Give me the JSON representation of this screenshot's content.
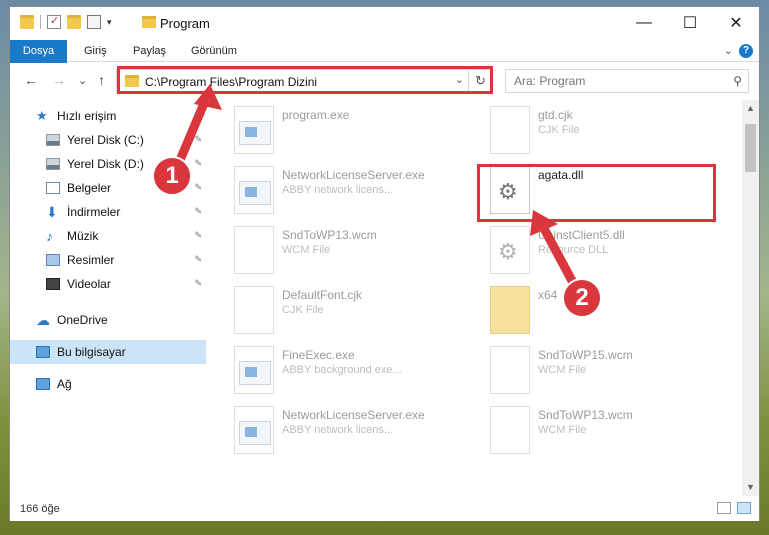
{
  "titlebar": {
    "title": "Program",
    "minimize": "—",
    "maximize": "☐",
    "close": "✕"
  },
  "ribbon": {
    "tabs": [
      "Dosya",
      "Giriş",
      "Paylaş",
      "Görünüm"
    ],
    "collapse": "⌄",
    "help": "?"
  },
  "nav": {
    "back": "←",
    "forward": "→",
    "recent": "⌄",
    "up": "↑",
    "address": "C:\\Program Files\\Program Dizini",
    "dropdown": "⌄",
    "refresh": "↻",
    "search_placeholder": "Ara: Program",
    "search_icon": "⚲"
  },
  "sidebar": {
    "items": [
      {
        "label": "Hızlı erişim",
        "icon": "star-icon"
      },
      {
        "label": "Yerel Disk (C:)",
        "icon": "drive-icon"
      },
      {
        "label": "Yerel Disk (D:)",
        "icon": "drive-icon"
      },
      {
        "label": "Belgeler",
        "icon": "documents-icon"
      },
      {
        "label": "İndirmeler",
        "icon": "downloads-icon"
      },
      {
        "label": "Müzik",
        "icon": "music-icon"
      },
      {
        "label": "Resimler",
        "icon": "pictures-icon"
      },
      {
        "label": "Videolar",
        "icon": "videos-icon"
      },
      {
        "label": "OneDrive",
        "icon": "onedrive-icon"
      },
      {
        "label": "Bu bilgisayar",
        "icon": "this-pc-icon"
      },
      {
        "label": "Ağ",
        "icon": "network-icon"
      }
    ],
    "pin": "📌"
  },
  "files": [
    {
      "name": "program.exe",
      "type": "",
      "kind": "exe"
    },
    {
      "name": "gtd.cjk",
      "type": "CJK File",
      "kind": "generic"
    },
    {
      "name": "NetworkLicenseServer.exe",
      "type": "ABBY network licens...",
      "kind": "exe"
    },
    {
      "name": "agata.dll",
      "type": "",
      "kind": "gear"
    },
    {
      "name": "SndToWP13.wcm",
      "type": "WCM File",
      "kind": "generic"
    },
    {
      "name": "UninstClient5.dll",
      "type": "Resource DLL",
      "kind": "gear"
    },
    {
      "name": "DefaultFont.cjk",
      "type": "CJK File",
      "kind": "generic"
    },
    {
      "name": "x64",
      "type": "",
      "kind": "folder"
    },
    {
      "name": "FineExec.exe",
      "type": "ABBY background exe...",
      "kind": "exe"
    },
    {
      "name": "SndToWP15.wcm",
      "type": "WCM File",
      "kind": "generic"
    },
    {
      "name": "NetworkLicenseServer.exe",
      "type": "ABBY network licens...",
      "kind": "exe"
    },
    {
      "name": "SndToWP13.wcm",
      "type": "WCM File",
      "kind": "generic"
    }
  ],
  "status": {
    "count": "166 öğe"
  },
  "annotations": {
    "badge1": "1",
    "badge2": "2"
  },
  "colors": {
    "accent": "#1979ca",
    "highlight": "#d9363e",
    "selection": "#cce4f7"
  }
}
